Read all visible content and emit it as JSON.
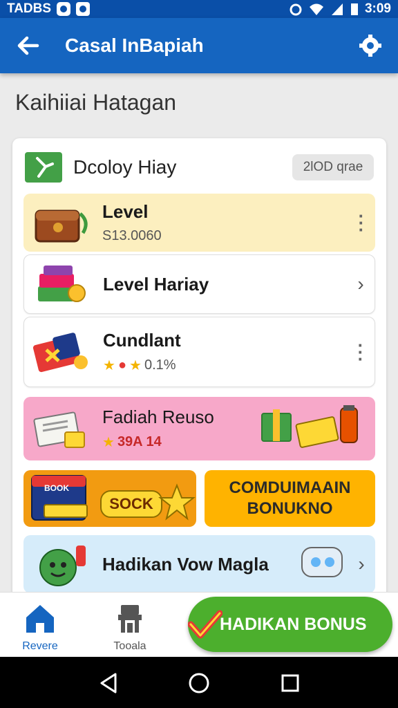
{
  "status_bar": {
    "left_text": "TADBS",
    "time": "3:09"
  },
  "app_bar": {
    "title": "Casal InBapiah"
  },
  "section_heading": "Kaihiiai Hatagan",
  "card": {
    "title": "Dcoloy Hiay",
    "pill": "2lOD qrae",
    "rows": [
      {
        "title": "Level",
        "subtitle": "S13.0060",
        "icon": "treasure-chest-icon",
        "action": "more-vertical-icon",
        "bg": "#fcefbf"
      },
      {
        "title": "Level  Hariay",
        "icon": "gift-books-icon",
        "action": "chevron-right-icon",
        "bg": "#ffffff"
      },
      {
        "title": "Cundlant",
        "rating_text": "0.1%",
        "icon": "ticket-box-icon",
        "action": "more-vertical-icon",
        "bg": "#ffffff"
      },
      {
        "title": "Fadiah Reuso",
        "rating_text": "39A 14",
        "icon": "papers-icon",
        "bg": "#f7a8c9"
      },
      {
        "title": "Hadikan Vow Magla",
        "icon": "character-icon",
        "action": "chevron-right-icon",
        "bg": "#d6ecfa"
      }
    ],
    "promo_left": {
      "label": "BOOK",
      "stock_label": "SOCK",
      "icon": "calendar-star-icon"
    },
    "promo_right": {
      "line1": "COMDUIMAAIN",
      "line2": "BONUKNO"
    }
  },
  "bottom_nav": {
    "items": [
      {
        "label": "Revere",
        "icon": "home-icon",
        "active": true
      },
      {
        "label": "Tooala",
        "icon": "shop-icon",
        "active": false
      }
    ],
    "bonus_button": "HADIKAN BONUS"
  },
  "colors": {
    "primary": "#1565c0",
    "accent_green": "#4caf2d",
    "orange": "#f29b11",
    "yellow": "#ffb300"
  }
}
